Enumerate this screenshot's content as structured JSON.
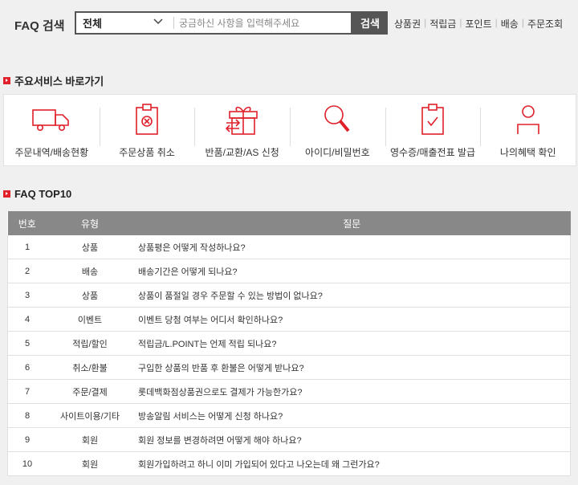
{
  "search": {
    "title": "FAQ 검색",
    "category_selected": "전체",
    "placeholder": "궁금하신 사항을 입력해주세요",
    "button_label": "검색",
    "quick_links": [
      "상품권",
      "적립금",
      "포인트",
      "배송",
      "주문조회"
    ]
  },
  "services": {
    "heading": "주요서비스 바로가기",
    "items": [
      {
        "label": "주문내역/배송현황",
        "icon": "delivery-truck-icon"
      },
      {
        "label": "주문상품 취소",
        "icon": "cancel-clipboard-icon"
      },
      {
        "label": "반품/교환/AS 신청",
        "icon": "return-exchange-gift-icon"
      },
      {
        "label": "아이디/비밀번호",
        "icon": "magnifier-icon"
      },
      {
        "label": "영수증/매출전표 발급",
        "icon": "receipt-check-icon"
      },
      {
        "label": "나의혜택 확인",
        "icon": "user-icon"
      }
    ]
  },
  "faq": {
    "heading": "FAQ TOP10",
    "columns": [
      "번호",
      "유형",
      "질문"
    ],
    "rows": [
      {
        "no": "1",
        "type": "상품",
        "question": "상품평은 어떻게 작성하나요?"
      },
      {
        "no": "2",
        "type": "배송",
        "question": "배송기간은 어떻게 되나요?"
      },
      {
        "no": "3",
        "type": "상품",
        "question": "상품이 품절일 경우 주문할 수 있는 방법이 없나요?"
      },
      {
        "no": "4",
        "type": "이벤트",
        "question": "이벤트 당첨 여부는 어디서 확인하나요?"
      },
      {
        "no": "5",
        "type": "적립/할인",
        "question": "적립금/L.POINT는 언제 적립 되나요?"
      },
      {
        "no": "6",
        "type": "취소/환불",
        "question": "구입한 상품의 반품 후 환불은 어떻게 받나요?"
      },
      {
        "no": "7",
        "type": "주문/결제",
        "question": "롯데백화점상품권으로도 결제가 가능한가요?"
      },
      {
        "no": "8",
        "type": "사이트이용/기타",
        "question": "방송알림 서비스는 어떻게 신청 하나요?"
      },
      {
        "no": "9",
        "type": "회원",
        "question": "회원 정보를 변경하려면 어떻게 해야 하나요?"
      },
      {
        "no": "10",
        "type": "회원",
        "question": "회원가입하려고 하니 이미 가입되어 있다고 나오는데 왜 그런가요?"
      }
    ]
  },
  "colors": {
    "accent": "#e0202a",
    "header_bg": "#888888",
    "search_button": "#555555"
  }
}
